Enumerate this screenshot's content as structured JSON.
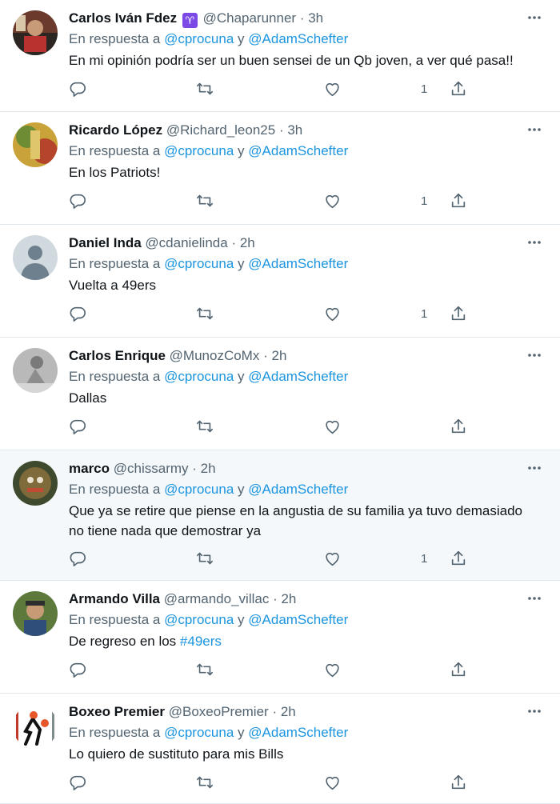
{
  "reply_prefix": "En respuesta a",
  "reply_joiner": "y",
  "mentions": [
    "@cprocuna",
    "@AdamSchefter"
  ],
  "colors": {
    "link": "#1b95e0",
    "secondary": "#536471",
    "highlight_bg": "#f5f8fa",
    "zodiac": "#7b4ae6"
  },
  "icons": [
    "more-icon",
    "reply-icon",
    "retweet-icon",
    "like-icon",
    "share-icon"
  ],
  "tweets": [
    {
      "name": "Carlos Iván Fdez",
      "badge": "♈",
      "handle": "@Chaparunner",
      "time": "3h",
      "text": "En mi opinión podría ser un buen sensei de un Qb joven, a ver qué pasa!!",
      "likes": "1"
    },
    {
      "name": "Ricardo López",
      "handle": "@Richard_leon25",
      "time": "3h",
      "text": "En los Patriots!",
      "likes": "1"
    },
    {
      "name": "Daniel Inda",
      "handle": "@cdanielinda",
      "time": "2h",
      "text": "Vuelta a 49ers",
      "likes": "1"
    },
    {
      "name": "Carlos Enrique",
      "handle": "@MunozCoMx",
      "time": "2h",
      "text": "Dallas",
      "likes": ""
    },
    {
      "name": "marco",
      "handle": "@chissarmy",
      "time": "2h",
      "text": "Que ya se retire que piense en la angustia de su familia ya tuvo demasiado no tiene nada que demostrar ya",
      "likes": "1"
    },
    {
      "name": "Armando Villa",
      "handle": "@armando_villac",
      "time": "2h",
      "text": "De regreso en los ",
      "hashtag": "#49ers",
      "likes": ""
    },
    {
      "name": "Boxeo Premier",
      "handle": "@BoxeoPremier",
      "time": "2h",
      "text": "Lo quiero de sustituto para mis Bills",
      "likes": ""
    }
  ]
}
